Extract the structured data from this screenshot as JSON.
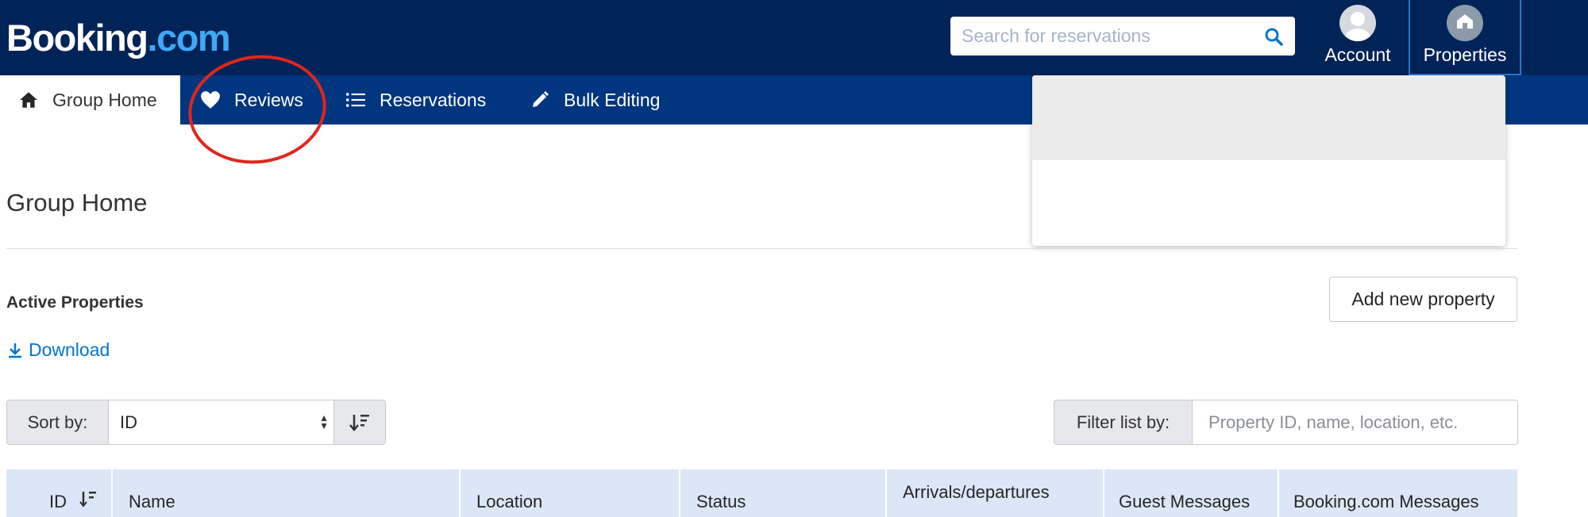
{
  "header": {
    "logo_main": "Booking",
    "logo_tld": ".com",
    "search_placeholder": "Search for reservations",
    "account_label": "Account",
    "properties_label": "Properties"
  },
  "nav": {
    "items": [
      {
        "label": "Group Home",
        "icon": "home-icon",
        "active": true
      },
      {
        "label": "Reviews",
        "icon": "heart-icon",
        "active": false
      },
      {
        "label": "Reservations",
        "icon": "list-icon",
        "active": false
      },
      {
        "label": "Bulk Editing",
        "icon": "pencil-icon",
        "active": false
      }
    ]
  },
  "page": {
    "title": "Group Home",
    "section_title": "Active Properties",
    "add_button": "Add new property",
    "download_label": "Download"
  },
  "controls": {
    "sort_label": "Sort by:",
    "sort_value": "ID",
    "filter_label": "Filter list by:",
    "filter_placeholder": "Property ID, name, location, etc."
  },
  "table": {
    "columns": [
      "ID",
      "Name",
      "Location",
      "Status",
      "Arrivals/departures",
      "Guest Messages",
      "Booking.com Messages"
    ]
  },
  "colors": {
    "topbar": "#002358",
    "navbar": "#003580",
    "accent_link": "#0077cc",
    "annotation_circle": "#e0261b",
    "table_header": "#dbe7f6"
  }
}
